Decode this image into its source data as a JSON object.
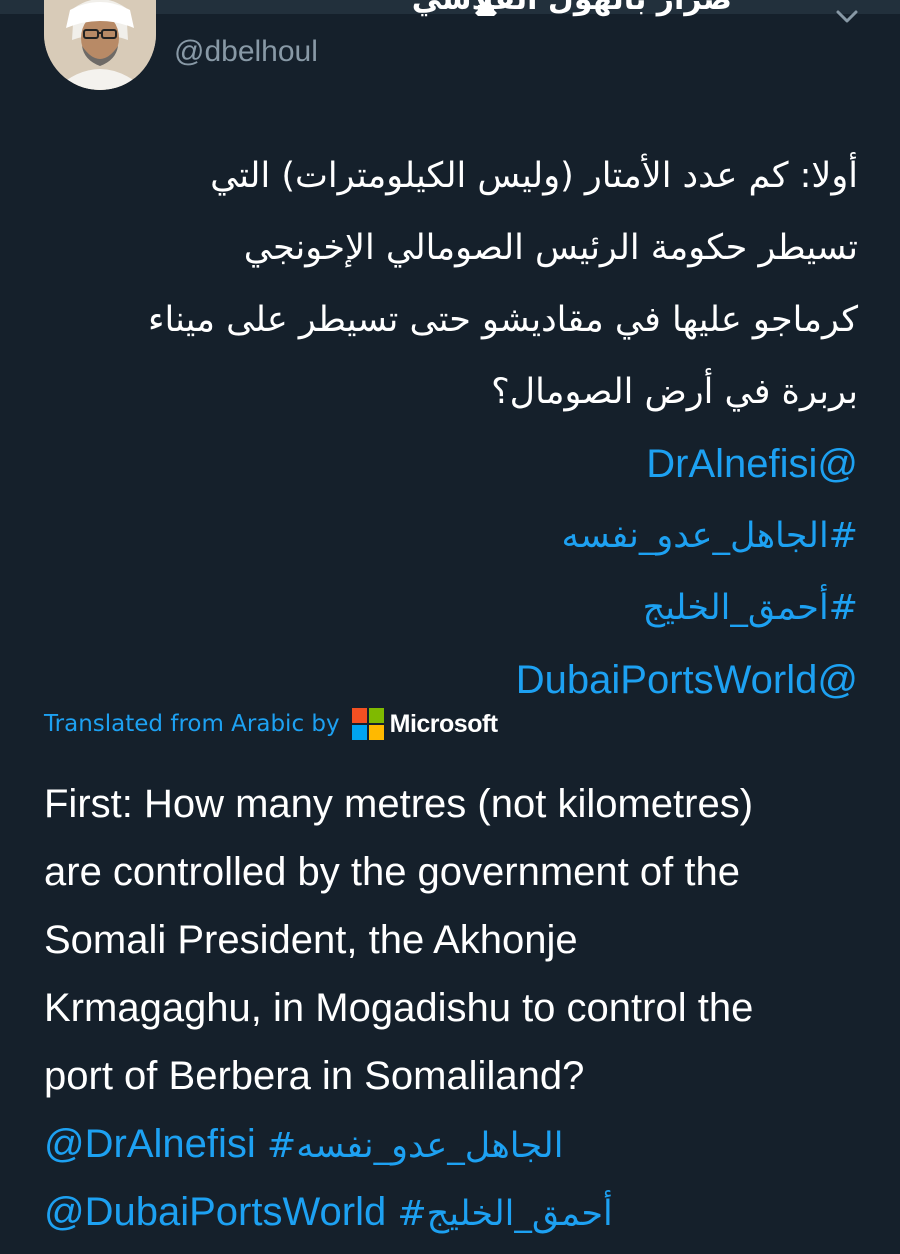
{
  "header": {
    "display_name": "ضرار بالهول الفلاسي",
    "handle": "@dbelhoul",
    "verified_icon": "verified-badge-icon",
    "menu_icon": "chevron-down-icon"
  },
  "tweet": {
    "arabic_lines": [
      "أولا: كم عدد الأمتار (وليس الكيلومترات) التي",
      "تسيطر حكومة الرئيس الصومالي الإخونجي",
      "كرماجو عليها في مقاديشو حتى تسيطر على ميناء",
      "بربرة في أرض الصومال؟"
    ],
    "arabic_links": [
      "@DrAlnefisi",
      "#الجاهل_عدو_نفسه",
      "#أحمق_الخليج",
      "@DubaiPortsWorld"
    ]
  },
  "translation": {
    "label": "Translated from Arabic by",
    "brand": "Microsoft",
    "brand_colors": [
      "#f25022",
      "#7fba00",
      "#00a4ef",
      "#ffb900"
    ],
    "english_lines": [
      "First: How many metres (not kilometres)",
      "are controlled by the government of the",
      "Somali President, the Akhonje",
      "Krmagaghu, in Mogadishu to control the",
      "port of Berbera in Somaliland?"
    ],
    "link_line_1": {
      "mention": "@DrAlnefisi",
      "hashtag": "#الجاهل_عدو_نفسه"
    },
    "link_line_2": {
      "mention": "@DubaiPortsWorld",
      "hashtag": "#أحمق_الخليج"
    }
  },
  "colors": {
    "background": "#15202b",
    "link": "#1da1f2",
    "secondary_text": "#8899a6"
  }
}
